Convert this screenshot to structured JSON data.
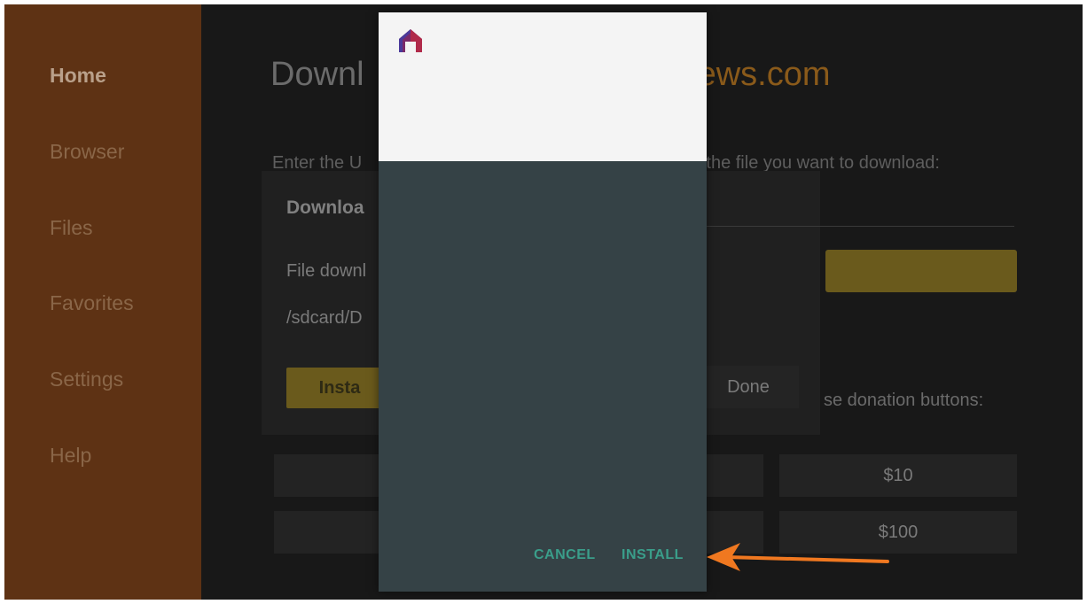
{
  "sidebar": {
    "items": [
      {
        "label": "Home",
        "active": true
      },
      {
        "label": "Browser"
      },
      {
        "label": "Files"
      },
      {
        "label": "Favorites"
      },
      {
        "label": "Settings"
      },
      {
        "label": "Help"
      }
    ]
  },
  "main": {
    "title_start": "Downl",
    "title_end": "ews.com",
    "url_prompt_start": "Enter the U",
    "url_prompt_end": "r the file you want to download:",
    "panel_heading": "Downloa",
    "file_label": "File downl",
    "file_path": "/sdcard/D",
    "install_label": "Insta",
    "done_label": "Done",
    "donation_text": "se donation buttons:",
    "donations": [
      "$10",
      "$100"
    ]
  },
  "dialog": {
    "icon": "house-app-icon",
    "cancel_label": "CANCEL",
    "install_label": "INSTALL"
  },
  "annotation": {
    "icon": "arrow-left-icon",
    "color": "#f07820"
  },
  "colors": {
    "sidebar": "#5e3214",
    "dialog_body": "#354246",
    "dialog_button": "#3a9e8a",
    "accent_yellow": "#6a5a1c"
  }
}
